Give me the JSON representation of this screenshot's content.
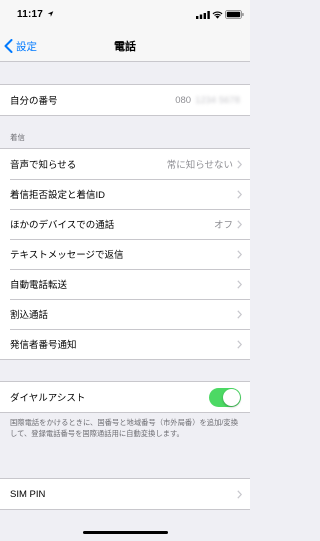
{
  "status_bar": {
    "time": "11:17",
    "icons": [
      "location-arrow-icon",
      "cellular-signal-icon",
      "wifi-icon",
      "battery-icon"
    ]
  },
  "nav": {
    "back_label": "設定",
    "title": "電話"
  },
  "my_number": {
    "label": "自分の番号",
    "value_prefix": "080",
    "value_hidden": "1234 5678"
  },
  "calls_section": {
    "header": "着信",
    "items": [
      {
        "label": "音声で知らせる",
        "value": "常に知らせない"
      },
      {
        "label": "着信拒否設定と着信ID",
        "value": ""
      },
      {
        "label": "ほかのデバイスでの通話",
        "value": "オフ"
      },
      {
        "label": "テキストメッセージで返信",
        "value": ""
      },
      {
        "label": "自動電話転送",
        "value": ""
      },
      {
        "label": "割込通話",
        "value": ""
      },
      {
        "label": "発信者番号通知",
        "value": ""
      }
    ]
  },
  "dial_assist": {
    "label": "ダイヤルアシスト",
    "enabled": true,
    "footnote": "国際電話をかけるときに、国番号と地域番号（市外局番）を追加/変換して、登録電話番号を国際通話用に自動変換します。"
  },
  "sim": {
    "label": "SIM PIN"
  },
  "colors": {
    "accent": "#007aff",
    "toggle_on": "#4cd964",
    "background": "#efeff4",
    "secondary_text": "#8e8e93"
  }
}
